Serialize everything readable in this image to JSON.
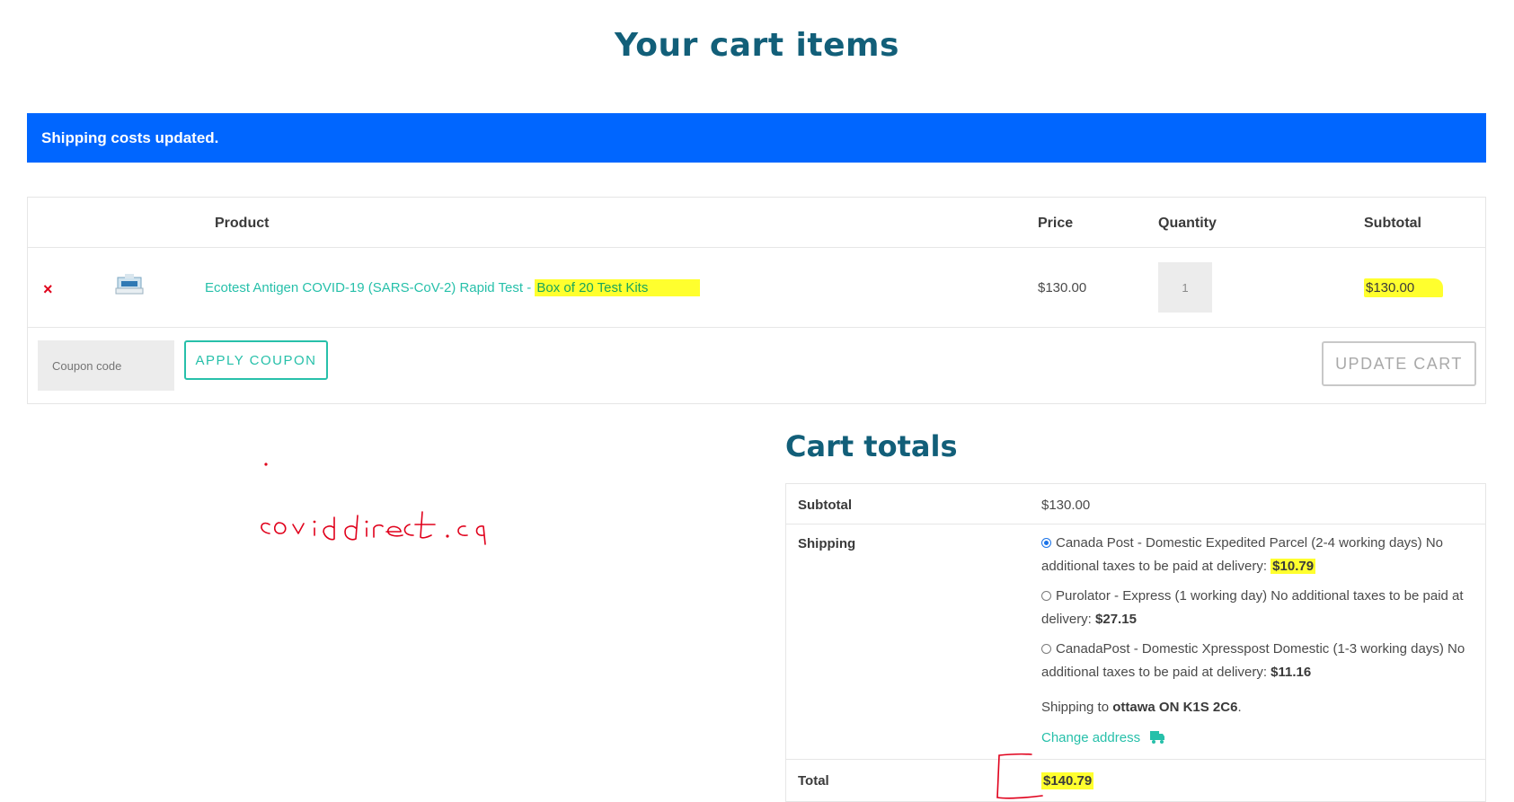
{
  "page": {
    "title": "Your cart items"
  },
  "notice": {
    "message": "Shipping costs updated."
  },
  "cart": {
    "headers": {
      "product": "Product",
      "price": "Price",
      "quantity": "Quantity",
      "subtotal": "Subtotal"
    },
    "items": [
      {
        "remove_symbol": "×",
        "name_main": "Ecotest Antigen COVID-19 (SARS-CoV-2) Rapid Test - ",
        "name_variant": "Box of 20 Test Kits",
        "price": "$130.00",
        "quantity": "1",
        "subtotal": "$130.00",
        "thumbnail_icon": "product-box-icon"
      }
    ],
    "coupon": {
      "placeholder": "Coupon code",
      "apply_label": "APPLY COUPON"
    },
    "update_label": "UPDATE CART"
  },
  "annotation": {
    "handwritten_text": "coviddirect.ca",
    "color": "#e0001b"
  },
  "totals": {
    "title": "Cart totals",
    "subtotal_label": "Subtotal",
    "subtotal_value": "$130.00",
    "shipping_label": "Shipping",
    "shipping_options": [
      {
        "text": "Canada Post - Domestic Expedited Parcel (2-4 working days) No additional taxes to be paid at delivery: ",
        "price": "$10.79",
        "selected": true,
        "highlighted": true
      },
      {
        "text": "Purolator - Express (1 working day) No additional taxes to be paid at delivery: ",
        "price": "$27.15",
        "selected": false,
        "highlighted": false
      },
      {
        "text": "CanadaPost - Domestic Xpresspost Domestic (1-3 working days) No additional taxes to be paid at delivery: ",
        "price": "$11.16",
        "selected": false,
        "highlighted": false
      }
    ],
    "shipping_to_prefix": "Shipping to ",
    "shipping_to_address": "ottawa ON K1S 2C6",
    "shipping_to_suffix": ".",
    "change_address_label": "Change address",
    "change_address_icon": "truck-icon",
    "total_label": "Total",
    "total_value": "$140.79"
  },
  "colors": {
    "title": "#125f79",
    "notice_bg": "#0066ff",
    "link": "#27c0aa",
    "highlight": "#ffff2e",
    "remove": "#e0001b"
  }
}
